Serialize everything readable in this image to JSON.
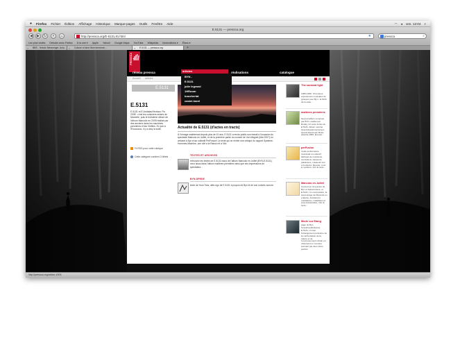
{
  "menubar": {
    "app": "Firefox",
    "items": [
      "Fichier",
      "Édition",
      "Affichage",
      "Historique",
      "Marque-pages",
      "Outils",
      "Fenêtre",
      "Aide"
    ],
    "clock": "ven. 12:04"
  },
  "window": {
    "title": "E.5131 — pressca.org"
  },
  "toolbar": {
    "back": "◀",
    "forward": "▶",
    "reload": "↻",
    "home": "⌂",
    "url": "http://pressca.org/E-5131,81.html",
    "search_value": "pressca"
  },
  "bookmarks": [
    "Les plus visités",
    "Débuter avec Firefox",
    "À la une ▾",
    "Apple",
    "Yahoo!",
    "Google Maps",
    "YouTube",
    "Wikipédia",
    "Informations ▾",
    "Élans ▾"
  ],
  "tabs": [
    {
      "label": "BBS - Hebdo Messenger, Actu...",
      "active": false
    },
    {
      "label": "Culture et âme libre emmené...",
      "active": false
    },
    {
      "label": "E.5131 — pressca.org",
      "active": true
    }
  ],
  "status": "http://pressca.org/article-4905",
  "site": {
    "logo_text": "PRESSCA",
    "nav": [
      "réseau pressca",
      "artistes",
      "réalisations",
      "catalogue"
    ],
    "dropdown": [
      "BYN -",
      "E.5131",
      "julie legrand",
      "1HRoom",
      "boucheriat",
      "castel-harel"
    ],
    "breadcrumb": [
      "Accueil",
      "artistes"
    ],
    "left_title": "E.5131",
    "heading": "E.5131",
    "left_text": "E.5131 et E.Andalas/Ventura. Fin 2008 : c'est les cuisiniers avisés de Marcelle, puis le troisième album de l'album Mancolo en 2009 réalisé par des anciens dans les machines premières et les Vieilles. En juin à l'Eccaucus, il y a cinq la suite.",
    "rss_line": "Fil RSS pour cette rubrique",
    "cat_line": "Cette catégorie contient 3 billets",
    "main_title": "Actualité de E.5131 (d'actes en tracts)",
    "main_text": "À l'ovnage maintenant depuis plus de 10 ans, E.5131 a rendu public son travail à l'occasion du spectacle Mancolo en Juillet, et de la première partie du concert de Von Magnet (Mai 2007) en arrivant à 5yn et au collectif PerFusion! Le texte qui se révèle une critique du rapport Système-Hommes-Machine, une clef à la Raison et à l'Art.",
    "sections": [
      {
        "head": "TEXTES ET ARCHIVES",
        "text": "retrouvez les textes de E.5131 issus de l'album Mancolo en Juillet (BYN-E.5131), ceux issus dans l'album matières premières ainsi que ses impressions de spectateur..."
      },
      {
        "head": "BYN-SPEDE",
        "text": "texte de Hum Toks, aller-ego de E.5131 à propos de Byn et de son univers sonore."
      }
    ],
    "right_items": [
      {
        "title": "The sunbeat light",
        "text": "1965-1996 : Premières expériences musicales de groupes pour Byn : E.5131 de la suite..."
      },
      {
        "title": "matières premières",
        "text": "Second album composé par BYN, réalisé par Roday, Un texte inclus de E.5131, Album nominé Grand Expérimental aux Quartz Electronic Music Awards 2005. Écouter..."
      },
      {
        "title": "perFusion",
        "text": "Cette performance réunissait un collectif fabriqué de musiciens, comédiens, danseurs, plasticiens, créateurs son et lumières. Écouter, c'est le système. Voir la suite..."
      },
      {
        "title": "Mancolo en Juillet",
        "text": "Concert en cinq actes de Byn et Spiral Colère, et E.5131. Un compositeur, la personnage de Mancolo en enfance. Ambiances méditatives, malathées et post-industrielles. Voir la suite..."
      },
      {
        "title": "Morte sur Etang",
        "text": "page de Byn, Smeall.audinstanca, E.5131. Un lieu l'étrangement purissime de la confrontation de la nature et de l'environnement urbain en observant un monstre pensant par deux êtres perdus."
      }
    ]
  }
}
